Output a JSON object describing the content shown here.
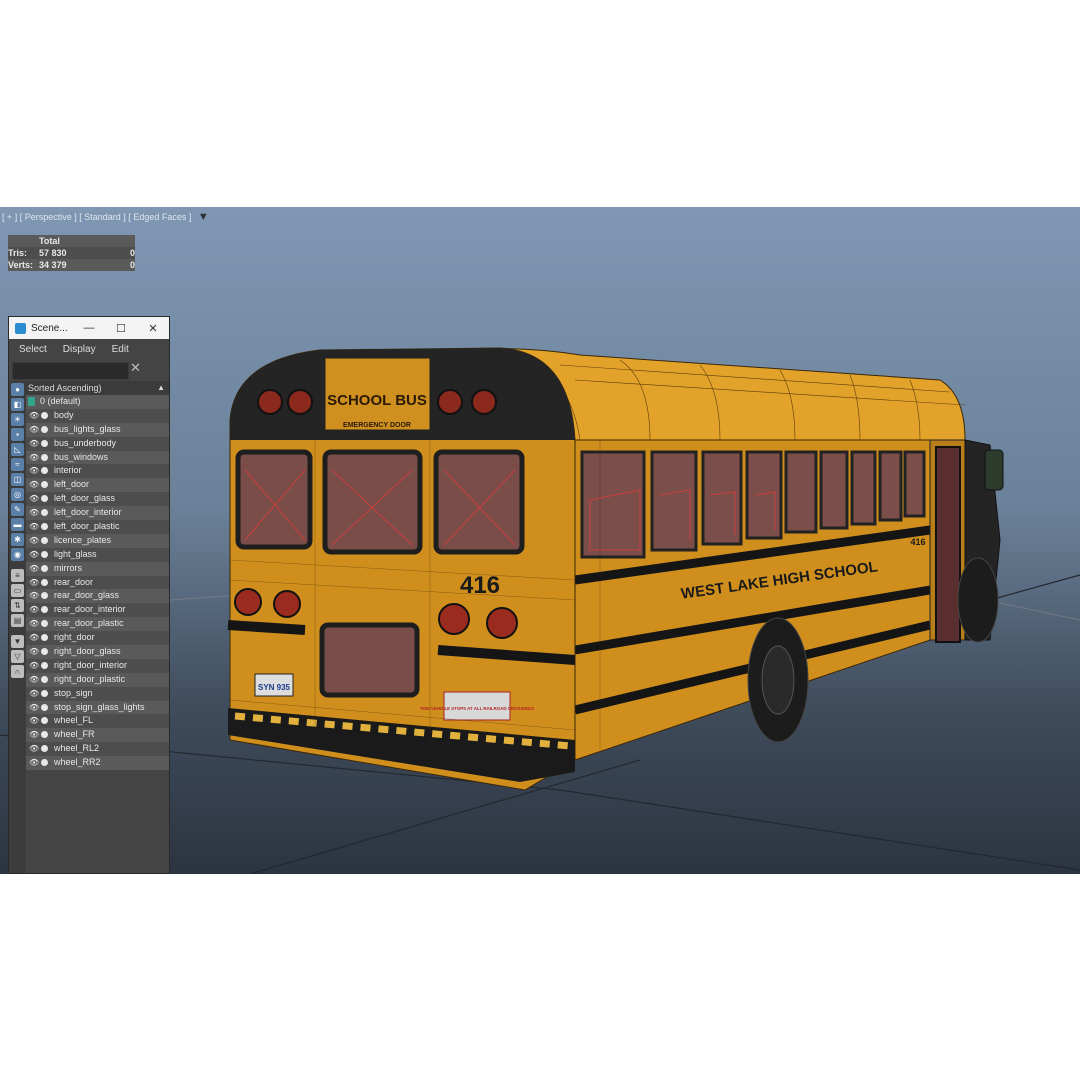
{
  "viewport": {
    "label": "[ + ] [ Perspective ] [ Standard ] [ Edged Faces ]",
    "stats": {
      "header": "Total",
      "rows": [
        {
          "label": "Tris:",
          "total": "57 830",
          "selected": "0"
        },
        {
          "label": "Verts:",
          "total": "34 379",
          "selected": "0"
        }
      ]
    },
    "model_text": {
      "top_sign": "SCHOOL BUS",
      "emergency": "EMERGENCY DOOR",
      "bus_number": "416",
      "side_text": "WEST LAKE HIGH SCHOOL",
      "front_number": "416",
      "plate": "SYN 935",
      "rail_sign": "THIS VEHICLE STOPS AT ALL RAILROAD CROSSINGS"
    }
  },
  "scene_explorer": {
    "title": "Scene...",
    "window_buttons": [
      "—",
      "☐",
      "✕"
    ],
    "menu": [
      "Select",
      "Display",
      "Edit"
    ],
    "search_placeholder": "",
    "sort_label": "Sorted Ascending)",
    "layer": "0 (default)",
    "items": [
      "body",
      "bus_lights_glass",
      "bus_underbody",
      "bus_windows",
      "interior",
      "left_door",
      "left_door_glass",
      "left_door_interior",
      "left_door_plastic",
      "licence_plates",
      "light_glass",
      "mirrors",
      "rear_door",
      "rear_door_glass",
      "rear_door_interior",
      "rear_door_plastic",
      "right_door",
      "right_door_glass",
      "right_door_interior",
      "right_door_plastic",
      "stop_sign",
      "stop_sign_glass_lights",
      "wheel_FL",
      "wheel_FR",
      "wheel_RL2",
      "wheel_RR2"
    ]
  },
  "colors": {
    "bus_yellow": "#d7951c",
    "stripe": "#1a1a1a",
    "window_red": "#c83030"
  }
}
